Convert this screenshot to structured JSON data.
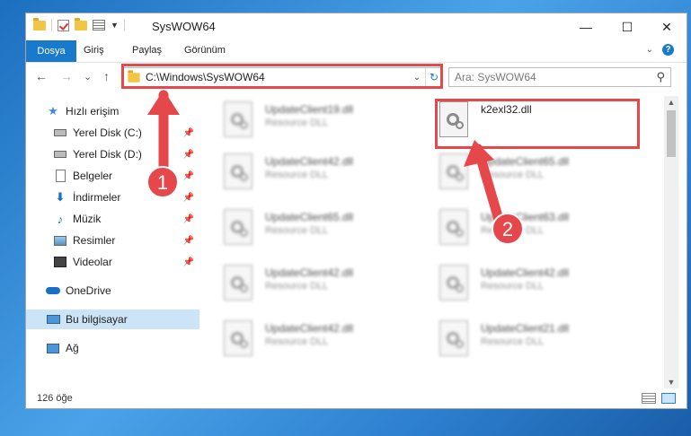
{
  "window": {
    "title": "SysWOW64",
    "controls": {
      "minimize": "—",
      "maximize": "☐",
      "close": "✕"
    }
  },
  "ribbon": {
    "tabs": [
      "Dosya",
      "Giriş",
      "Paylaş",
      "Görünüm"
    ],
    "help": "?"
  },
  "nav": {
    "back": "←",
    "forward": "→",
    "recent": "⌄",
    "up": "↑",
    "address": "C:\\Windows\\SysWOW64",
    "refresh": "↻",
    "search_placeholder": "Ara: SysWOW64"
  },
  "sidebar": {
    "items": [
      {
        "label": "Hızlı erişim",
        "icon": "star-icon"
      },
      {
        "label": "Yerel Disk (C:)",
        "icon": "drive-icon",
        "pinned": true
      },
      {
        "label": "Yerel Disk (D:)",
        "icon": "drive-icon",
        "pinned": true
      },
      {
        "label": "Belgeler",
        "icon": "document-icon",
        "pinned": true
      },
      {
        "label": "İndirmeler",
        "icon": "download-icon",
        "pinned": true
      },
      {
        "label": "Müzik",
        "icon": "music-icon",
        "pinned": true
      },
      {
        "label": "Resimler",
        "icon": "pictures-icon",
        "pinned": true
      },
      {
        "label": "Videolar",
        "icon": "video-icon",
        "pinned": true
      },
      {
        "label": "OneDrive",
        "icon": "cloud-icon"
      },
      {
        "label": "Bu bilgisayar",
        "icon": "computer-icon",
        "selected": true
      },
      {
        "label": "Ağ",
        "icon": "network-icon"
      }
    ]
  },
  "files": {
    "left_column": [
      {
        "name": "UpdateClient19.dll",
        "type": "Resource DLL"
      },
      {
        "name": "UpdateClient42.dll",
        "type": "Resource DLL"
      },
      {
        "name": "UpdateClient65.dll",
        "type": "Resource DLL"
      },
      {
        "name": "UpdateClient42.dll",
        "type": "Resource DLL"
      },
      {
        "name": "UpdateClient42.dll",
        "type": "Resource DLL"
      }
    ],
    "right_column": [
      {
        "name": "k2exl32.dll",
        "type": ""
      },
      {
        "name": "UpdateClient65.dll",
        "type": "Resource DLL"
      },
      {
        "name": "UpdateClient63.dll",
        "type": "Resource DLL"
      },
      {
        "name": "UpdateClient42.dll",
        "type": "Resource DLL"
      },
      {
        "name": "UpdateClient21.dll",
        "type": "Resource DLL"
      }
    ]
  },
  "status": {
    "item_count": "126 öğe"
  },
  "annotations": {
    "step1": "1",
    "step2": "2",
    "color": "#e5474b"
  }
}
